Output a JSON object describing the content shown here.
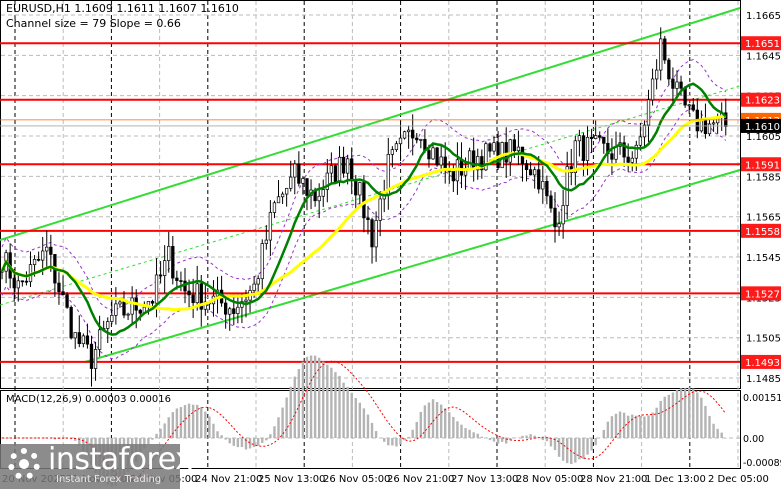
{
  "header": {
    "symbol_line": "EURUSD,H1  1.1609 1.1611 1.1607 1.1610",
    "channel_line": "Channel size = 79 Slope = 0.66"
  },
  "macd": {
    "label": "MACD(12,26,9) 0.00003 0.00016",
    "ticks": [
      "0.00151",
      "0.00",
      "-0.00089"
    ]
  },
  "logo": {
    "name": "instaforex",
    "tagline": "Instant Forex Trading"
  },
  "colors": {
    "level": "#ff0000",
    "channel": "#33dd33",
    "ma_fast": "#008000",
    "ma_slow": "#ffff00",
    "envelope": "#9933cc",
    "macd_hist": "#b4b4b4",
    "macd_signal": "#ff0000"
  },
  "chart_data": {
    "type": "candlestick",
    "title": "EURUSD,H1",
    "ylim": [
      1.1478,
      1.1672
    ],
    "y_ticks": [
      "1.1665",
      "1.1645",
      "1.1625",
      "1.1605",
      "1.1585",
      "1.1565",
      "1.1545",
      "1.1525",
      "1.1505",
      "1.1485"
    ],
    "levels": [
      "1.1651",
      "1.1623",
      "1.1591",
      "1.1558",
      "1.1527",
      "1.1493"
    ],
    "current_price": "1.1610",
    "ask_label": "1.1613",
    "x_labels": [
      "20 Nov 2025",
      "21 Nov 13:00",
      "24 Nov 05:00",
      "24 Nov 21:00",
      "25 Nov 13:00",
      "26 Nov 05:00",
      "26 Nov 21:00",
      "27 Nov 13:00",
      "28 Nov 05:00",
      "28 Nov 21:00",
      "1 Dec 13:00",
      "2 Dec 05:00"
    ],
    "price_path": [
      [
        0,
        1.1545
      ],
      [
        4,
        1.153
      ],
      [
        11,
        1.1548
      ],
      [
        18,
        1.1505
      ],
      [
        22,
        1.1495
      ],
      [
        27,
        1.1515
      ],
      [
        37,
        1.1525
      ],
      [
        41,
        1.1545
      ],
      [
        45,
        1.1528
      ],
      [
        57,
        1.152
      ],
      [
        62,
        1.153
      ],
      [
        67,
        1.157
      ],
      [
        72,
        1.1585
      ],
      [
        77,
        1.1575
      ],
      [
        85,
        1.1595
      ],
      [
        91,
        1.1555
      ],
      [
        95,
        1.159
      ],
      [
        102,
        1.161
      ],
      [
        110,
        1.1585
      ],
      [
        117,
        1.1595
      ],
      [
        127,
        1.1597
      ],
      [
        132,
        1.1585
      ],
      [
        136,
        1.156
      ],
      [
        141,
        1.16
      ],
      [
        150,
        1.1597
      ],
      [
        156,
        1.1595
      ],
      [
        160,
        1.163
      ],
      [
        162,
        1.165
      ],
      [
        166,
        1.1625
      ],
      [
        170,
        1.1612
      ],
      [
        178,
        1.161
      ]
    ]
  }
}
